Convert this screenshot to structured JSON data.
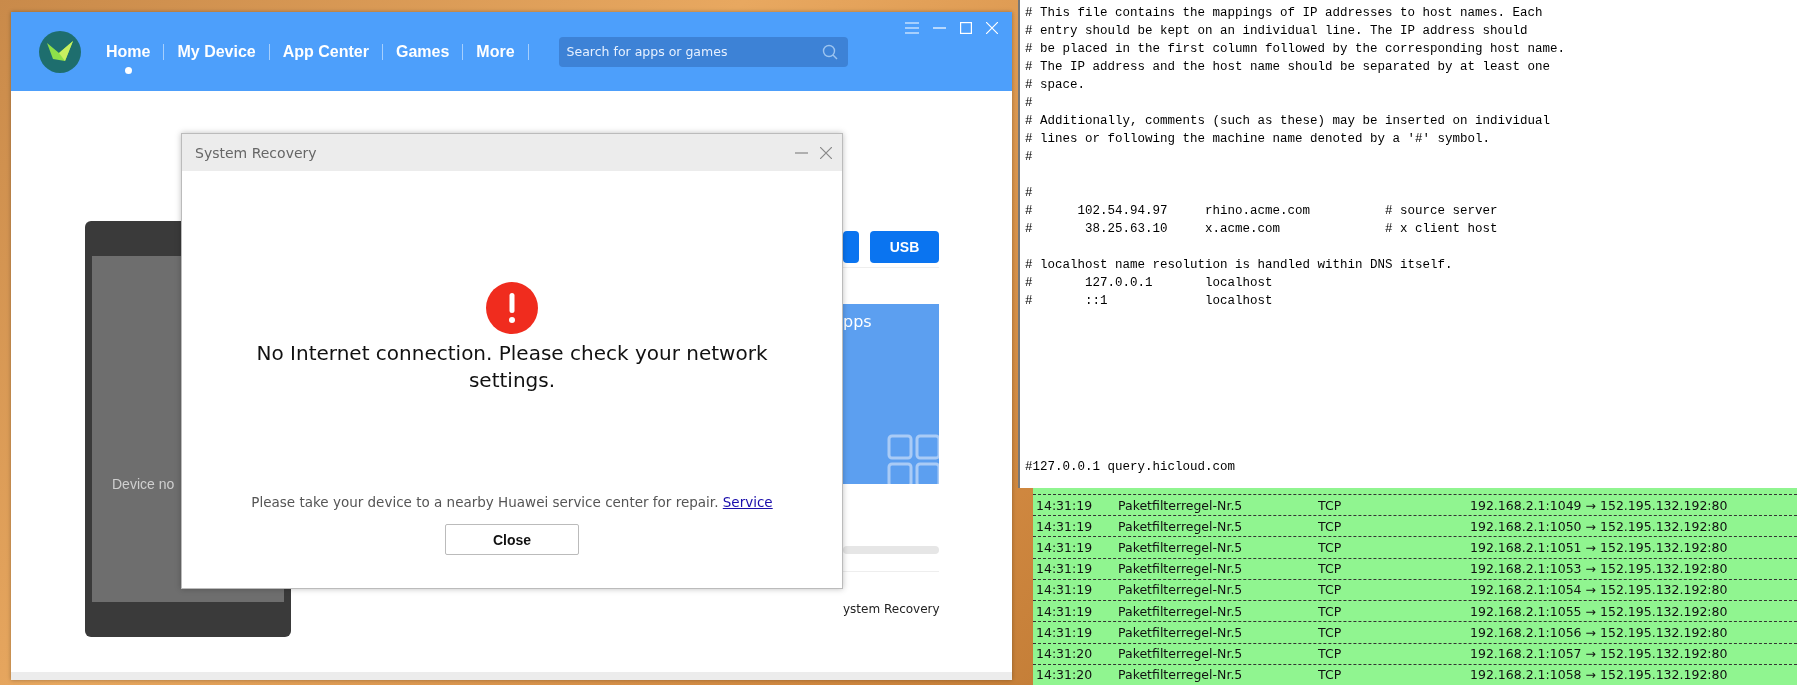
{
  "app": {
    "nav": [
      {
        "label": "Home",
        "selected": true
      },
      {
        "label": "My Device",
        "selected": false
      },
      {
        "label": "App Center",
        "selected": false
      },
      {
        "label": "Games",
        "selected": false
      },
      {
        "label": "More",
        "selected": false
      }
    ],
    "search": {
      "placeholder": "Search for apps or games"
    },
    "phone": {
      "status": "Device no"
    },
    "connect_buttons": [
      "USB"
    ],
    "banner": {
      "title": "pps"
    },
    "recovery_link": "ystem Recovery"
  },
  "dialog": {
    "title": "System Recovery",
    "message": "No Internet connection. Please check your network settings.",
    "note": "Please take your device to a nearby Huawei service center for repair.",
    "link": "Service",
    "button": "Close"
  },
  "notepad": {
    "blocks": [
      [
        "# This file contains the mappings of IP addresses to host names. Each",
        "# entry should be kept on an individual line. The IP address should",
        "# be placed in the first column followed by the corresponding host name.",
        "# The IP address and the host name should be separated by at least one",
        "# space.",
        "#",
        "# Additionally, comments (such as these) may be inserted on individual",
        "# lines or following the machine name denoted by a '#' symbol.",
        "#"
      ],
      [
        "#",
        "#      102.54.94.97     rhino.acme.com          # source server",
        "#       38.25.63.10     x.acme.com              # x client host"
      ],
      [
        "# localhost name resolution is handled within DNS itself.",
        "#       127.0.0.1       localhost",
        "#       ::1             localhost"
      ]
    ],
    "last_line": "#127.0.0.1 query.hicloud.com"
  },
  "log": {
    "rows": [
      {
        "time": "14:31:19",
        "rule": "Paketfilterregel-Nr.5",
        "protocol": "TCP",
        "connection": "192.168.2.1:1049 → 152.195.132.192:80"
      },
      {
        "time": "14:31:19",
        "rule": "Paketfilterregel-Nr.5",
        "protocol": "TCP",
        "connection": "192.168.2.1:1050 → 152.195.132.192:80"
      },
      {
        "time": "14:31:19",
        "rule": "Paketfilterregel-Nr.5",
        "protocol": "TCP",
        "connection": "192.168.2.1:1051 → 152.195.132.192:80"
      },
      {
        "time": "14:31:19",
        "rule": "Paketfilterregel-Nr.5",
        "protocol": "TCP",
        "connection": "192.168.2.1:1053 → 152.195.132.192:80"
      },
      {
        "time": "14:31:19",
        "rule": "Paketfilterregel-Nr.5",
        "protocol": "TCP",
        "connection": "192.168.2.1:1054 → 152.195.132.192:80"
      },
      {
        "time": "14:31:19",
        "rule": "Paketfilterregel-Nr.5",
        "protocol": "TCP",
        "connection": "192.168.2.1:1055 → 152.195.132.192:80"
      },
      {
        "time": "14:31:19",
        "rule": "Paketfilterregel-Nr.5",
        "protocol": "TCP",
        "connection": "192.168.2.1:1056 → 152.195.132.192:80"
      },
      {
        "time": "14:31:20",
        "rule": "Paketfilterregel-Nr.5",
        "protocol": "TCP",
        "connection": "192.168.2.1:1057 → 152.195.132.192:80"
      },
      {
        "time": "14:31:20",
        "rule": "Paketfilterregel-Nr.5",
        "protocol": "TCP",
        "connection": "192.168.2.1:1058 → 152.195.132.192:80"
      }
    ]
  }
}
